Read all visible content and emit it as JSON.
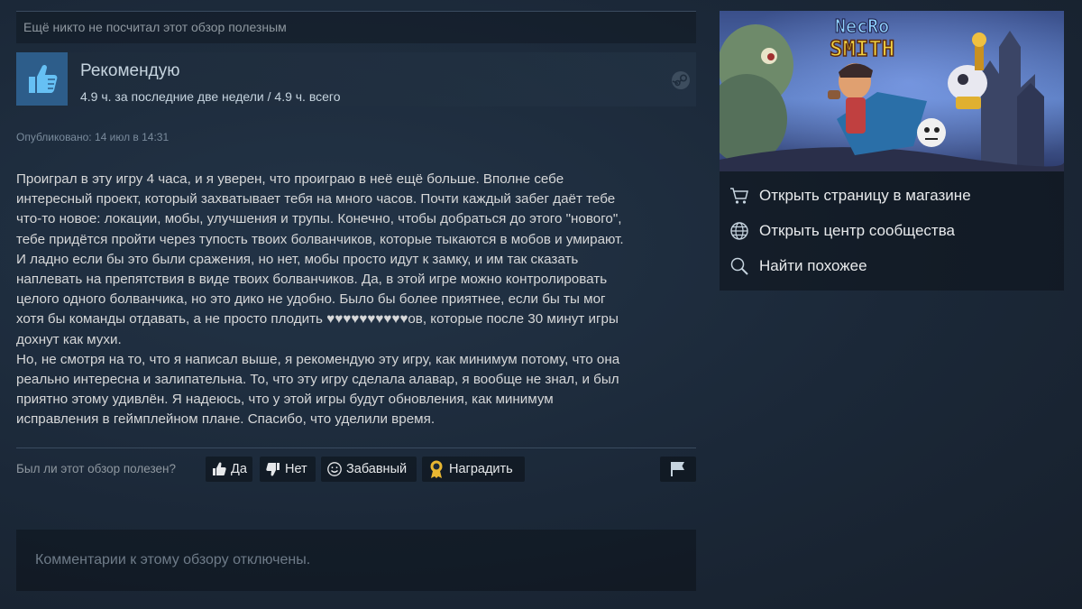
{
  "review": {
    "helpful_notice": "Ещё никто не посчитал этот обзор полезным",
    "recommendation": "Рекомендую",
    "hours": "4.9 ч. за последние две недели / 4.9 ч. всего",
    "posted": "Опубликовано: 14 июл в 14:31",
    "text": "Проиграл в эту игру 4 часа, и я уверен, что проиграю в неё ещё больше. Вполне себе\nинтересный проект, который захватывает тебя на много часов. Почти каждый забег даёт тебе\nчто-то новое: локации, мобы, улучшения и трупы. Конечно, чтобы добраться до этого \"нового\",\nтебе придётся пройти через тупость твоих болванчиков, которые тыкаются в мобов и умирают.\nИ ладно если бы это были сражения, но нет, мобы просто идут к замку, и им так сказать\nнаплевать на препятствия в виде твоих болванчиков. Да, в этой игре можно контролировать\nцелого одного болванчика, но это дико не удобно. Было бы более приятнее, если бы ты мог\nхотя бы команды отдавать, а не просто плодить ♥♥♥♥♥♥♥♥♥♥ов, которые после 30 минут игры\nдохнут как мухи.\nНо, не смотря на то, что я написал выше, я рекомендую эту игру, как минимум потому, что она\nреально интересна и залипательна. То, что эту игру сделала алавар, я вообще не знал, и был\nприятно этому удивлён. Я надеюсь, что у этой игры будут обновления, как минимум\nисправления в геймплейном плане. Спасибо, что уделили время."
  },
  "vote": {
    "question": "Был ли этот обзор полезен?",
    "yes": "Да",
    "no": "Нет",
    "funny": "Забавный",
    "award": "Наградить"
  },
  "comments": {
    "disabled": "Комментарии к этому обзору отключены."
  },
  "sidebar": {
    "game_logo_line1": "NecRo",
    "game_logo_line2": "SMITH",
    "links": [
      {
        "label": "Открыть страницу в магазине",
        "icon": "cart-icon"
      },
      {
        "label": "Открыть центр сообщества",
        "icon": "globe-icon"
      },
      {
        "label": "Найти похожее",
        "icon": "magnifier-icon"
      }
    ]
  },
  "colors": {
    "background": "#1b2838",
    "thumb_bg": "#2d5d8a",
    "text": "#d6d7d8",
    "muted": "#8f98a0",
    "award_gold": "#e8b732"
  }
}
